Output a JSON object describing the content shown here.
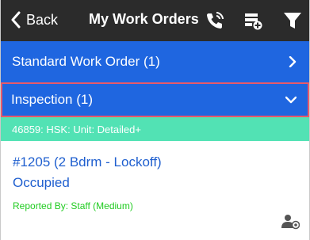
{
  "header": {
    "back_label": "Back",
    "title": "My Work Orders",
    "icons": [
      "phone-icon",
      "form-add-icon",
      "filter-icon"
    ]
  },
  "groups": [
    {
      "label": "Standard Work Order (1)",
      "state": "collapsed"
    },
    {
      "label": "Inspection (1)",
      "state": "expanded",
      "selected": true
    }
  ],
  "subgroup": {
    "label": "46859: HSK: Unit: Detailed+"
  },
  "work_order": {
    "title": "#1205 (2 Bdrm - Lockoff)",
    "status": "Occupied",
    "reported_by": "Reported By: Staff  (Medium)"
  },
  "colors": {
    "header": "#2b2b2b",
    "group_bg": "#1f66e0",
    "selected_border": "#e85a6a",
    "subgroup_bg": "#52e2b4",
    "link_text": "#1f5fcf",
    "reported_text": "#22cc22"
  }
}
